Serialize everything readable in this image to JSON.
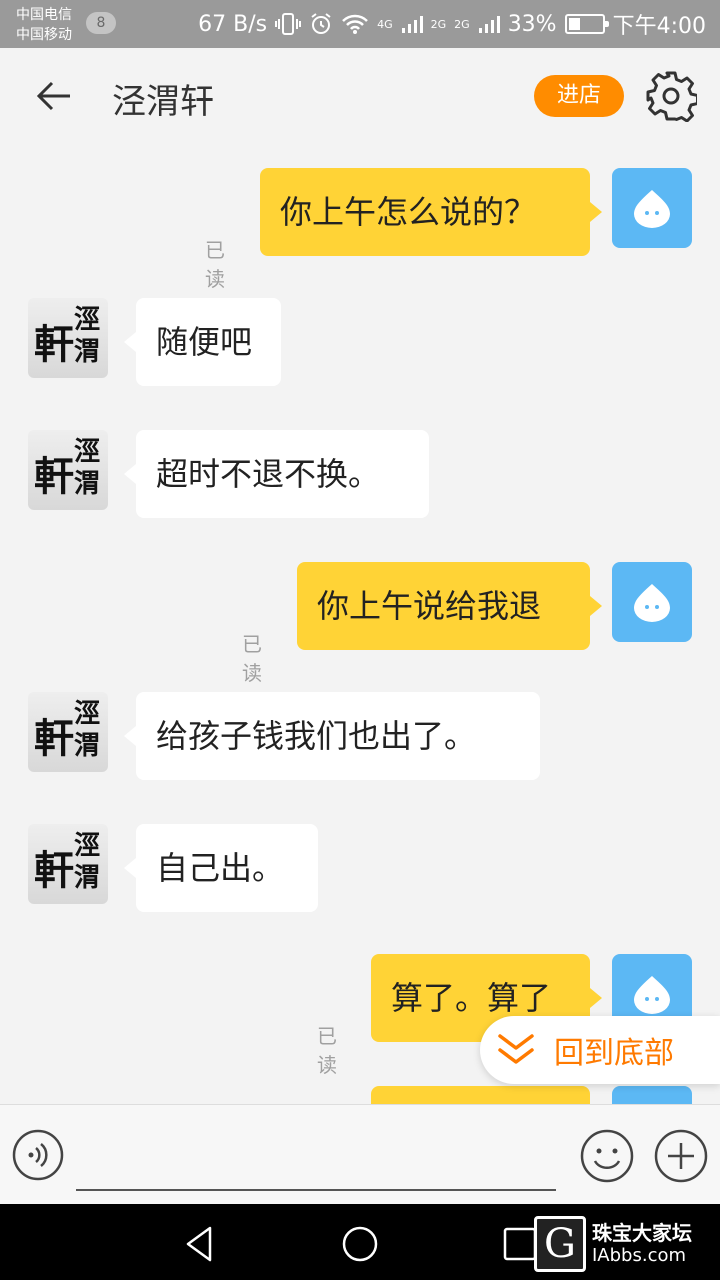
{
  "status_bar": {
    "carrier1": "中国电信",
    "carrier2": "中国移动",
    "notification_count": "8",
    "net_speed": "67 B/s",
    "net_4g": "4G",
    "net_2g_a": "2G",
    "net_2g_b": "2G",
    "battery": "33%",
    "time": "下午4:00"
  },
  "header": {
    "title": "泾渭轩",
    "store_button": "进店"
  },
  "shop_avatar": {
    "big_char": "軒",
    "col_chars": "涇渭"
  },
  "messages": [
    {
      "from": "me",
      "text": "你上午怎么说的？",
      "read": "已读"
    },
    {
      "from": "shop",
      "text": "随便吧"
    },
    {
      "from": "shop",
      "text": "超时不退不换。"
    },
    {
      "from": "me",
      "text": "你上午说给我退",
      "read": "已读"
    },
    {
      "from": "shop",
      "text": "给孩子钱我们也出了。"
    },
    {
      "from": "shop",
      "text": "自己出。"
    },
    {
      "from": "me",
      "text": "算了。算了",
      "read": "已读"
    },
    {
      "from": "me",
      "text": ""
    }
  ],
  "jump_to_bottom": "回到底部",
  "input": {
    "value": ""
  },
  "watermark": {
    "logo_letter": "G",
    "name": "珠宝大家坛",
    "url": "IAbbs.com"
  },
  "colors": {
    "my_bubble": "#ffd336",
    "shop_bubble": "#ffffff",
    "accent": "#ff8c00",
    "my_avatar": "#5cb8f4"
  },
  "icons": {
    "back": "back-arrow-icon",
    "settings": "gear-icon",
    "voice": "voice-icon",
    "emoji": "emoji-icon",
    "more": "plus-icon",
    "jump": "double-chevron-down-icon"
  }
}
